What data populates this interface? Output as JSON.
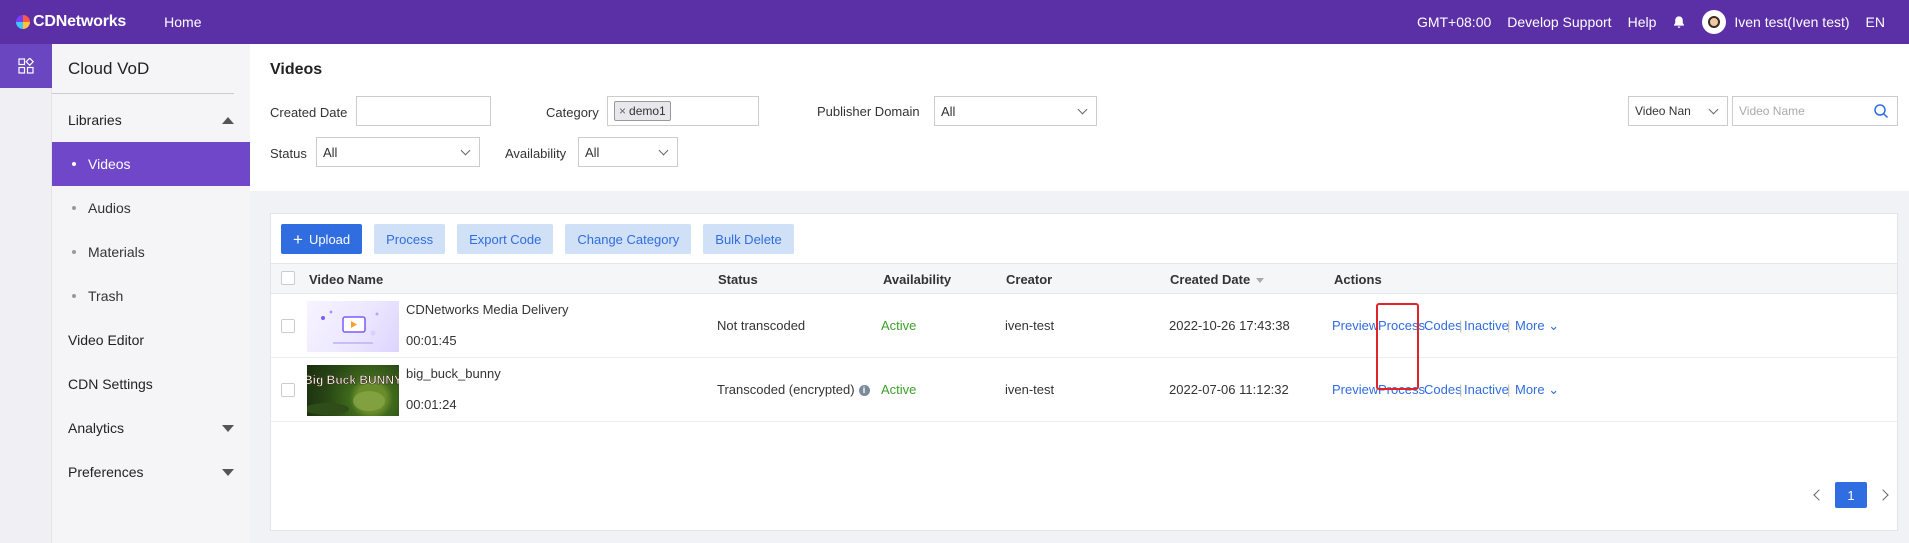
{
  "topbar": {
    "brand": "CDNetworks",
    "home": "Home",
    "timezone": "GMT+08:00",
    "develop_support": "Develop Support",
    "help": "Help",
    "user": "Iven test(Iven test)",
    "lang": "EN"
  },
  "sidebar": {
    "title": "Cloud VoD",
    "libraries": "Libraries",
    "sub_items": [
      "Videos",
      "Audios",
      "Materials",
      "Trash"
    ],
    "video_editor": "Video Editor",
    "cdn_settings": "CDN Settings",
    "analytics": "Analytics",
    "preferences": "Preferences"
  },
  "filters": {
    "page_title": "Videos",
    "created_date_label": "Created Date",
    "created_date_value": "",
    "category_label": "Category",
    "category_tag": "demo1",
    "publisher_domain_label": "Publisher Domain",
    "publisher_domain_value": "All",
    "status_label": "Status",
    "status_value": "All",
    "availability_label": "Availability",
    "availability_value": "All",
    "search_field": "Video Nan",
    "search_placeholder": "Video Name"
  },
  "toolbar": {
    "upload": "Upload",
    "process": "Process",
    "export_code": "Export Code",
    "change_category": "Change Category",
    "bulk_delete": "Bulk Delete"
  },
  "table": {
    "headers": {
      "video_name": "Video Name",
      "status": "Status",
      "availability": "Availability",
      "creator": "Creator",
      "created_date": "Created Date",
      "actions": "Actions"
    },
    "rows": [
      {
        "name": "CDNetworks Media Delivery",
        "duration": "00:01:45",
        "status": "Not transcoded",
        "availability": "Active",
        "creator": "iven-test",
        "created_date": "2022-10-26 17:43:38"
      },
      {
        "name": "big_buck_bunny",
        "duration": "00:01:24",
        "status": "Transcoded (encrypted)",
        "availability": "Active",
        "creator": "iven-test",
        "created_date": "2022-07-06 11:12:32",
        "thumb_text": "Big Buck BUNNY"
      }
    ],
    "actions": {
      "preview": "Preview",
      "process": "Process",
      "codes": "Codes",
      "inactive": "Inactive",
      "more": "More"
    }
  },
  "pagination": {
    "current": "1"
  },
  "colors": {
    "topbar": "#5b2fa6",
    "sidebar_active": "#7147c9",
    "primary": "#2f6de0",
    "active_status": "#3ba22a",
    "highlight": "#e0242a"
  }
}
